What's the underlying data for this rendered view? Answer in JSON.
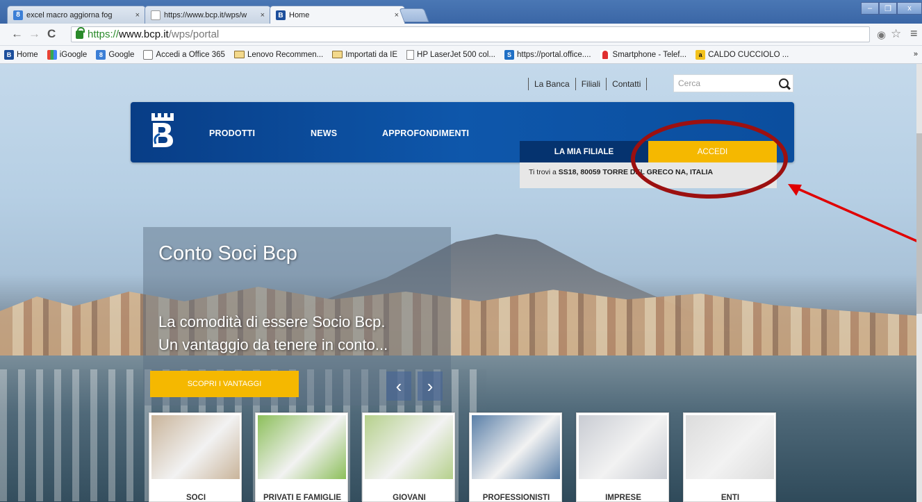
{
  "browser": {
    "tabs": [
      {
        "title": "excel macro aggiorna fog",
        "icon": "google-icon"
      },
      {
        "title": "https://www.bcp.it/wps/w",
        "icon": "page-icon"
      },
      {
        "title": "Home",
        "icon": "bcp-icon",
        "active": true
      }
    ],
    "tab_close": "×",
    "nav": {
      "back": "←",
      "forward": "→",
      "reload": "C"
    },
    "url": {
      "scheme": "https://",
      "host": "www.bcp.it",
      "path": "/wps/portal"
    },
    "bookmarks": [
      {
        "label": "Home",
        "icon": "bcp-icon"
      },
      {
        "label": "iGoogle",
        "icon": "igoogle-icon"
      },
      {
        "label": "Google",
        "icon": "google-icon"
      },
      {
        "label": "Accedi a Office 365",
        "icon": "office-icon"
      },
      {
        "label": "Lenovo Recommen...",
        "icon": "folder-icon"
      },
      {
        "label": "Importati da IE",
        "icon": "folder-icon"
      },
      {
        "label": "HP LaserJet 500 col...",
        "icon": "page-icon"
      },
      {
        "label": "https://portal.office....",
        "icon": "sharepoint-icon"
      },
      {
        "label": "Smartphone - Telef...",
        "icon": "vodafone-icon"
      },
      {
        "label": "CALDO CUCCIOLO ...",
        "icon": "amazon-icon"
      }
    ],
    "bookmarks_overflow": "»"
  },
  "site": {
    "util_links": [
      "La Banca",
      "Filiali",
      "Contatti"
    ],
    "search_placeholder": "Cerca",
    "nav_items": [
      "PRODOTTI",
      "NEWS",
      "APPROFONDIMENTI"
    ],
    "btn_filiale": "LA MIA FILIALE",
    "btn_accedi": "ACCEDI",
    "location_prefix": "Ti trovi a ",
    "location_value": "SS18, 80059 TORRE DEL GRECO NA, ITALIA",
    "promo": {
      "title": "Conto Soci Bcp",
      "line1": "La comodità di essere Socio Bcp.",
      "line2": "Un vantaggio da tenere in conto...",
      "button": "SCOPRI I VANTAGGI",
      "prev": "‹",
      "next": "›"
    },
    "cards": [
      {
        "label": "SOCI",
        "color": "#c9b49a"
      },
      {
        "label": "PRIVATI E FAMIGLIE",
        "color": "#8cbf5a"
      },
      {
        "label": "GIOVANI",
        "color": "#b5d08b"
      },
      {
        "label": "PROFESSIONISTI",
        "color": "#5a7fa8"
      },
      {
        "label": "IMPRESE",
        "color": "#c9ccd3"
      },
      {
        "label": "ENTI",
        "color": "#dcdcdc"
      }
    ]
  },
  "colors": {
    "brand_blue": "#0e57ab",
    "accent_yellow": "#f5b800",
    "annotation_red": "#9c1010"
  }
}
